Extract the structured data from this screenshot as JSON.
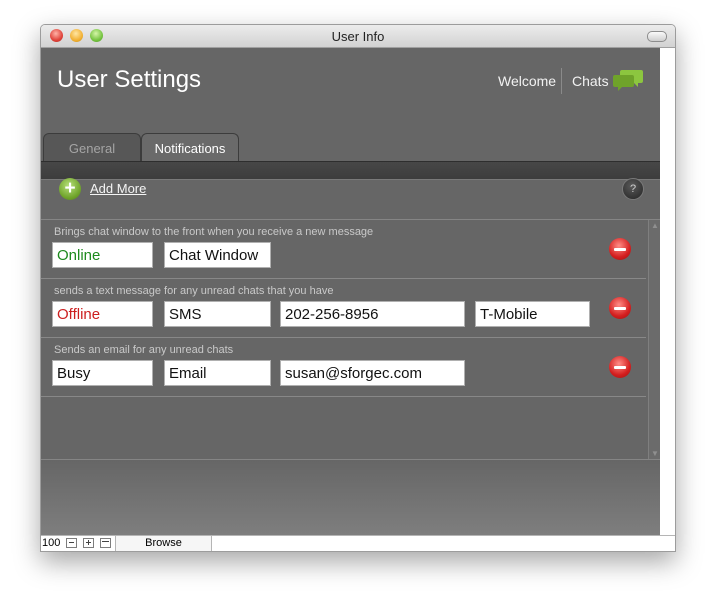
{
  "window": {
    "title": "User Info"
  },
  "header": {
    "title": "User Settings",
    "welcome": "Welcome",
    "chats": "Chats"
  },
  "tabs": [
    {
      "label": "General",
      "selected": false
    },
    {
      "label": "Notifications",
      "selected": true
    }
  ],
  "toolbar": {
    "add_label": "Add More",
    "help_icon": "?"
  },
  "notifications": [
    {
      "description": "Brings chat window to the front when you receive a new message",
      "status": "Online",
      "status_color": "#1d8a1d",
      "method": "Chat Window"
    },
    {
      "description": "sends a text message for any unread chats that you have",
      "status": "Offline",
      "status_color": "#cc1f1f",
      "method": "SMS",
      "phone": "202-256-8956",
      "carrier": "T-Mobile"
    },
    {
      "description": "Sends an email for any unread chats",
      "status": "Busy",
      "status_color": "#111111",
      "method": "Email",
      "email": "susan@sforgec.com"
    }
  ],
  "statusbar": {
    "zoom": "100",
    "mode": "Browse"
  },
  "colors": {
    "accent_green": "#7ab532",
    "remove_red": "#d41f1f",
    "panel_gray": "#666666"
  }
}
